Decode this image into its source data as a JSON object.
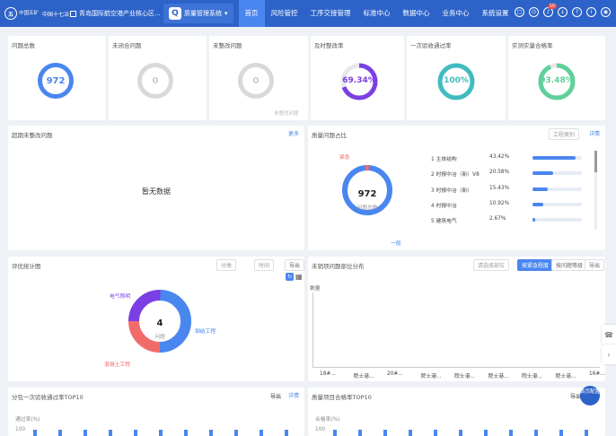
{
  "header": {
    "logo_text": "中国五矿",
    "logo2_text": "中国十七冶",
    "project": "青岛国际航空港产业核心区...",
    "system": "质量管理系统",
    "system_q": "Q",
    "nav": [
      "首页",
      "风险管控",
      "工序交接管理",
      "标准中心",
      "数据中心",
      "业务中心",
      "系统设置"
    ],
    "notif_badge": "10"
  },
  "stats": [
    {
      "title": "问题总数",
      "value": "972",
      "color": "#4a86f0"
    },
    {
      "title": "未闭合问题",
      "value": "0",
      "color": "#d9d9d9"
    },
    {
      "title": "未整改问题",
      "value": "0",
      "color": "#d9d9d9",
      "note": "未整改问题"
    },
    {
      "title": "及时整改率",
      "value": "69.34%",
      "color": "#7b3fe4",
      "fraction": 0.6934
    },
    {
      "title": "一次验收通过率",
      "value": "100%",
      "color": "#40bcc0",
      "fraction": 1.0
    },
    {
      "title": "实测实量合格率",
      "value": "93.48%",
      "color": "#5fd09a",
      "fraction": 0.9348
    }
  ],
  "overdue": {
    "title": "超期未整改问题",
    "more": "更多",
    "empty": "暂无数据"
  },
  "ratio": {
    "title": "质量问题占比",
    "filter": "工程类别",
    "detail": "详情",
    "center_value": "972",
    "center_label": "问题总数",
    "label_urgent": "紧急",
    "label_normal": "一般",
    "items": [
      {
        "label": "1 主体结构",
        "pct": "43.42%",
        "fraction": 0.4342
      },
      {
        "label": "2 时报中冶（新）V8",
        "pct": "20.58%",
        "fraction": 0.2058
      },
      {
        "label": "3 时报中冶（新）",
        "pct": "15.43%",
        "fraction": 0.1543
      },
      {
        "label": "4 时报中冶",
        "pct": "10.92%",
        "fraction": 0.1092
      },
      {
        "label": "5 建筑电气",
        "pct": "2.67%",
        "fraction": 0.0267
      }
    ]
  },
  "review": {
    "title": "评优统计图",
    "filter1": "分类",
    "filter2": "时间",
    "export": "导出",
    "center_value": "4",
    "center_label": "问题",
    "labels": [
      "电气照明",
      "钢结工程",
      "混凝土工程"
    ]
  },
  "location": {
    "title": "未销项问题部位分布",
    "filter": "请选择部位",
    "btn1": "按紧急程度",
    "btn2": "按问题等级",
    "export": "导出",
    "ylabel": "数量",
    "ticks": [
      "18#...",
      "院士港...",
      "20#...",
      "院士港...",
      "院士港...",
      "院士港...",
      "院士港...",
      "院士港...",
      "16#..."
    ]
  },
  "bottom_left": {
    "title": "分包一次验收通过率TOP10",
    "export": "导出",
    "detail": "详情",
    "ylabel": "通过率(%)",
    "ytick": "100"
  },
  "bottom_right": {
    "title": "质量项目合格率TOP10",
    "export": "导出",
    "ylabel": "合格率(%)",
    "ytick": "100",
    "float_btn": "首页配置"
  }
}
